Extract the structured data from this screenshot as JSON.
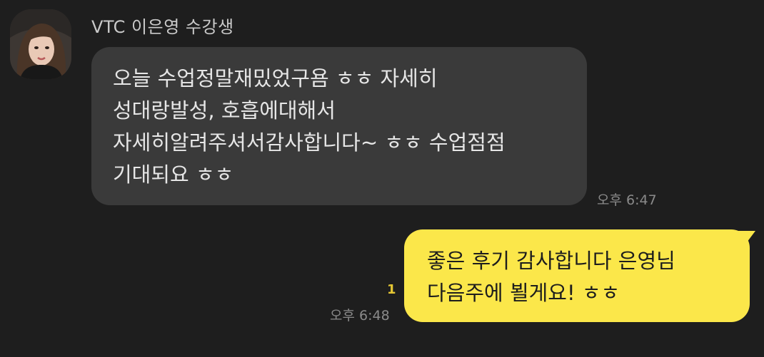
{
  "chat": {
    "sender_name": "VTC 이은영 수강생",
    "incoming": {
      "lines": [
        "오늘 수업정말재밌었구욤 ㅎㅎ 자세히",
        "성대랑발성, 호흡에대해서",
        "자세히알려주셔서감사합니다~ ㅎㅎ 수업점점",
        "기대되요 ㅎㅎ"
      ],
      "time": "오후 6:47"
    },
    "outgoing": {
      "lines": [
        "좋은 후기 감사합니다 은영님",
        "다음주에 뵐게요! ㅎㅎ"
      ],
      "time": "오후 6:48",
      "unread_count": "1"
    }
  },
  "colors": {
    "background": "#1e1e1e",
    "incoming_bubble": "#3a3a3a",
    "outgoing_bubble": "#fbe74a",
    "unread_count": "#e5c734"
  }
}
